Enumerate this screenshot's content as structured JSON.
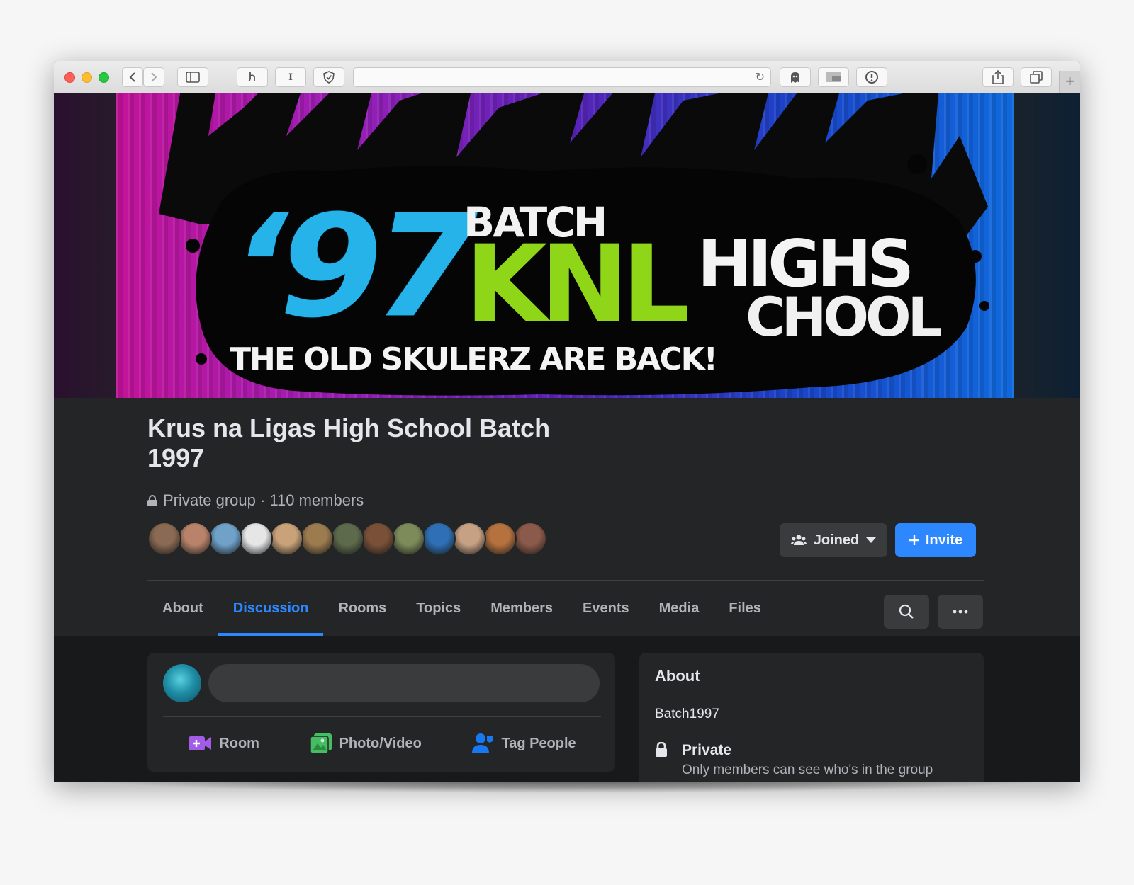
{
  "browser": {
    "address_text": ""
  },
  "group": {
    "title": "Krus na Ligas High School Batch 1997",
    "meta": "Private group · 110 members",
    "member_avatar_colors": [
      "#8a6a52",
      "#b8836a",
      "#6fa1c9",
      "#e6e6e6",
      "#c9a27a",
      "#9c7b4f",
      "#5d6b4c",
      "#7a5138",
      "#7d8b5a",
      "#2f6fb5",
      "#c6a184",
      "#b5713e",
      "#8c5a4a"
    ],
    "joined_label": "Joined",
    "invite_label": "Invite"
  },
  "cover": {
    "line_97": "‘97",
    "line_batch": "BATCH",
    "line_knl": "KNL",
    "line_highs": "HIGHS",
    "line_chool": "CHOOL",
    "tagline": "THE OLD SKULERZ ARE BACK!"
  },
  "tabs": [
    {
      "label": "About",
      "active": false
    },
    {
      "label": "Discussion",
      "active": true
    },
    {
      "label": "Rooms",
      "active": false
    },
    {
      "label": "Topics",
      "active": false
    },
    {
      "label": "Members",
      "active": false
    },
    {
      "label": "Events",
      "active": false
    },
    {
      "label": "Media",
      "active": false
    },
    {
      "label": "Files",
      "active": false
    }
  ],
  "composer": {
    "placeholder": "",
    "actions": [
      {
        "label": "Room",
        "icon": "video-room-icon"
      },
      {
        "label": "Photo/Video",
        "icon": "photo-icon"
      },
      {
        "label": "Tag People",
        "icon": "tag-people-icon"
      }
    ]
  },
  "about": {
    "title": "About",
    "description": "Batch1997",
    "privacy_title": "Private",
    "privacy_desc": "Only members can see who's in the group"
  },
  "colors": {
    "accent": "#2d88ff",
    "surface": "#242526",
    "background": "#18191a"
  }
}
